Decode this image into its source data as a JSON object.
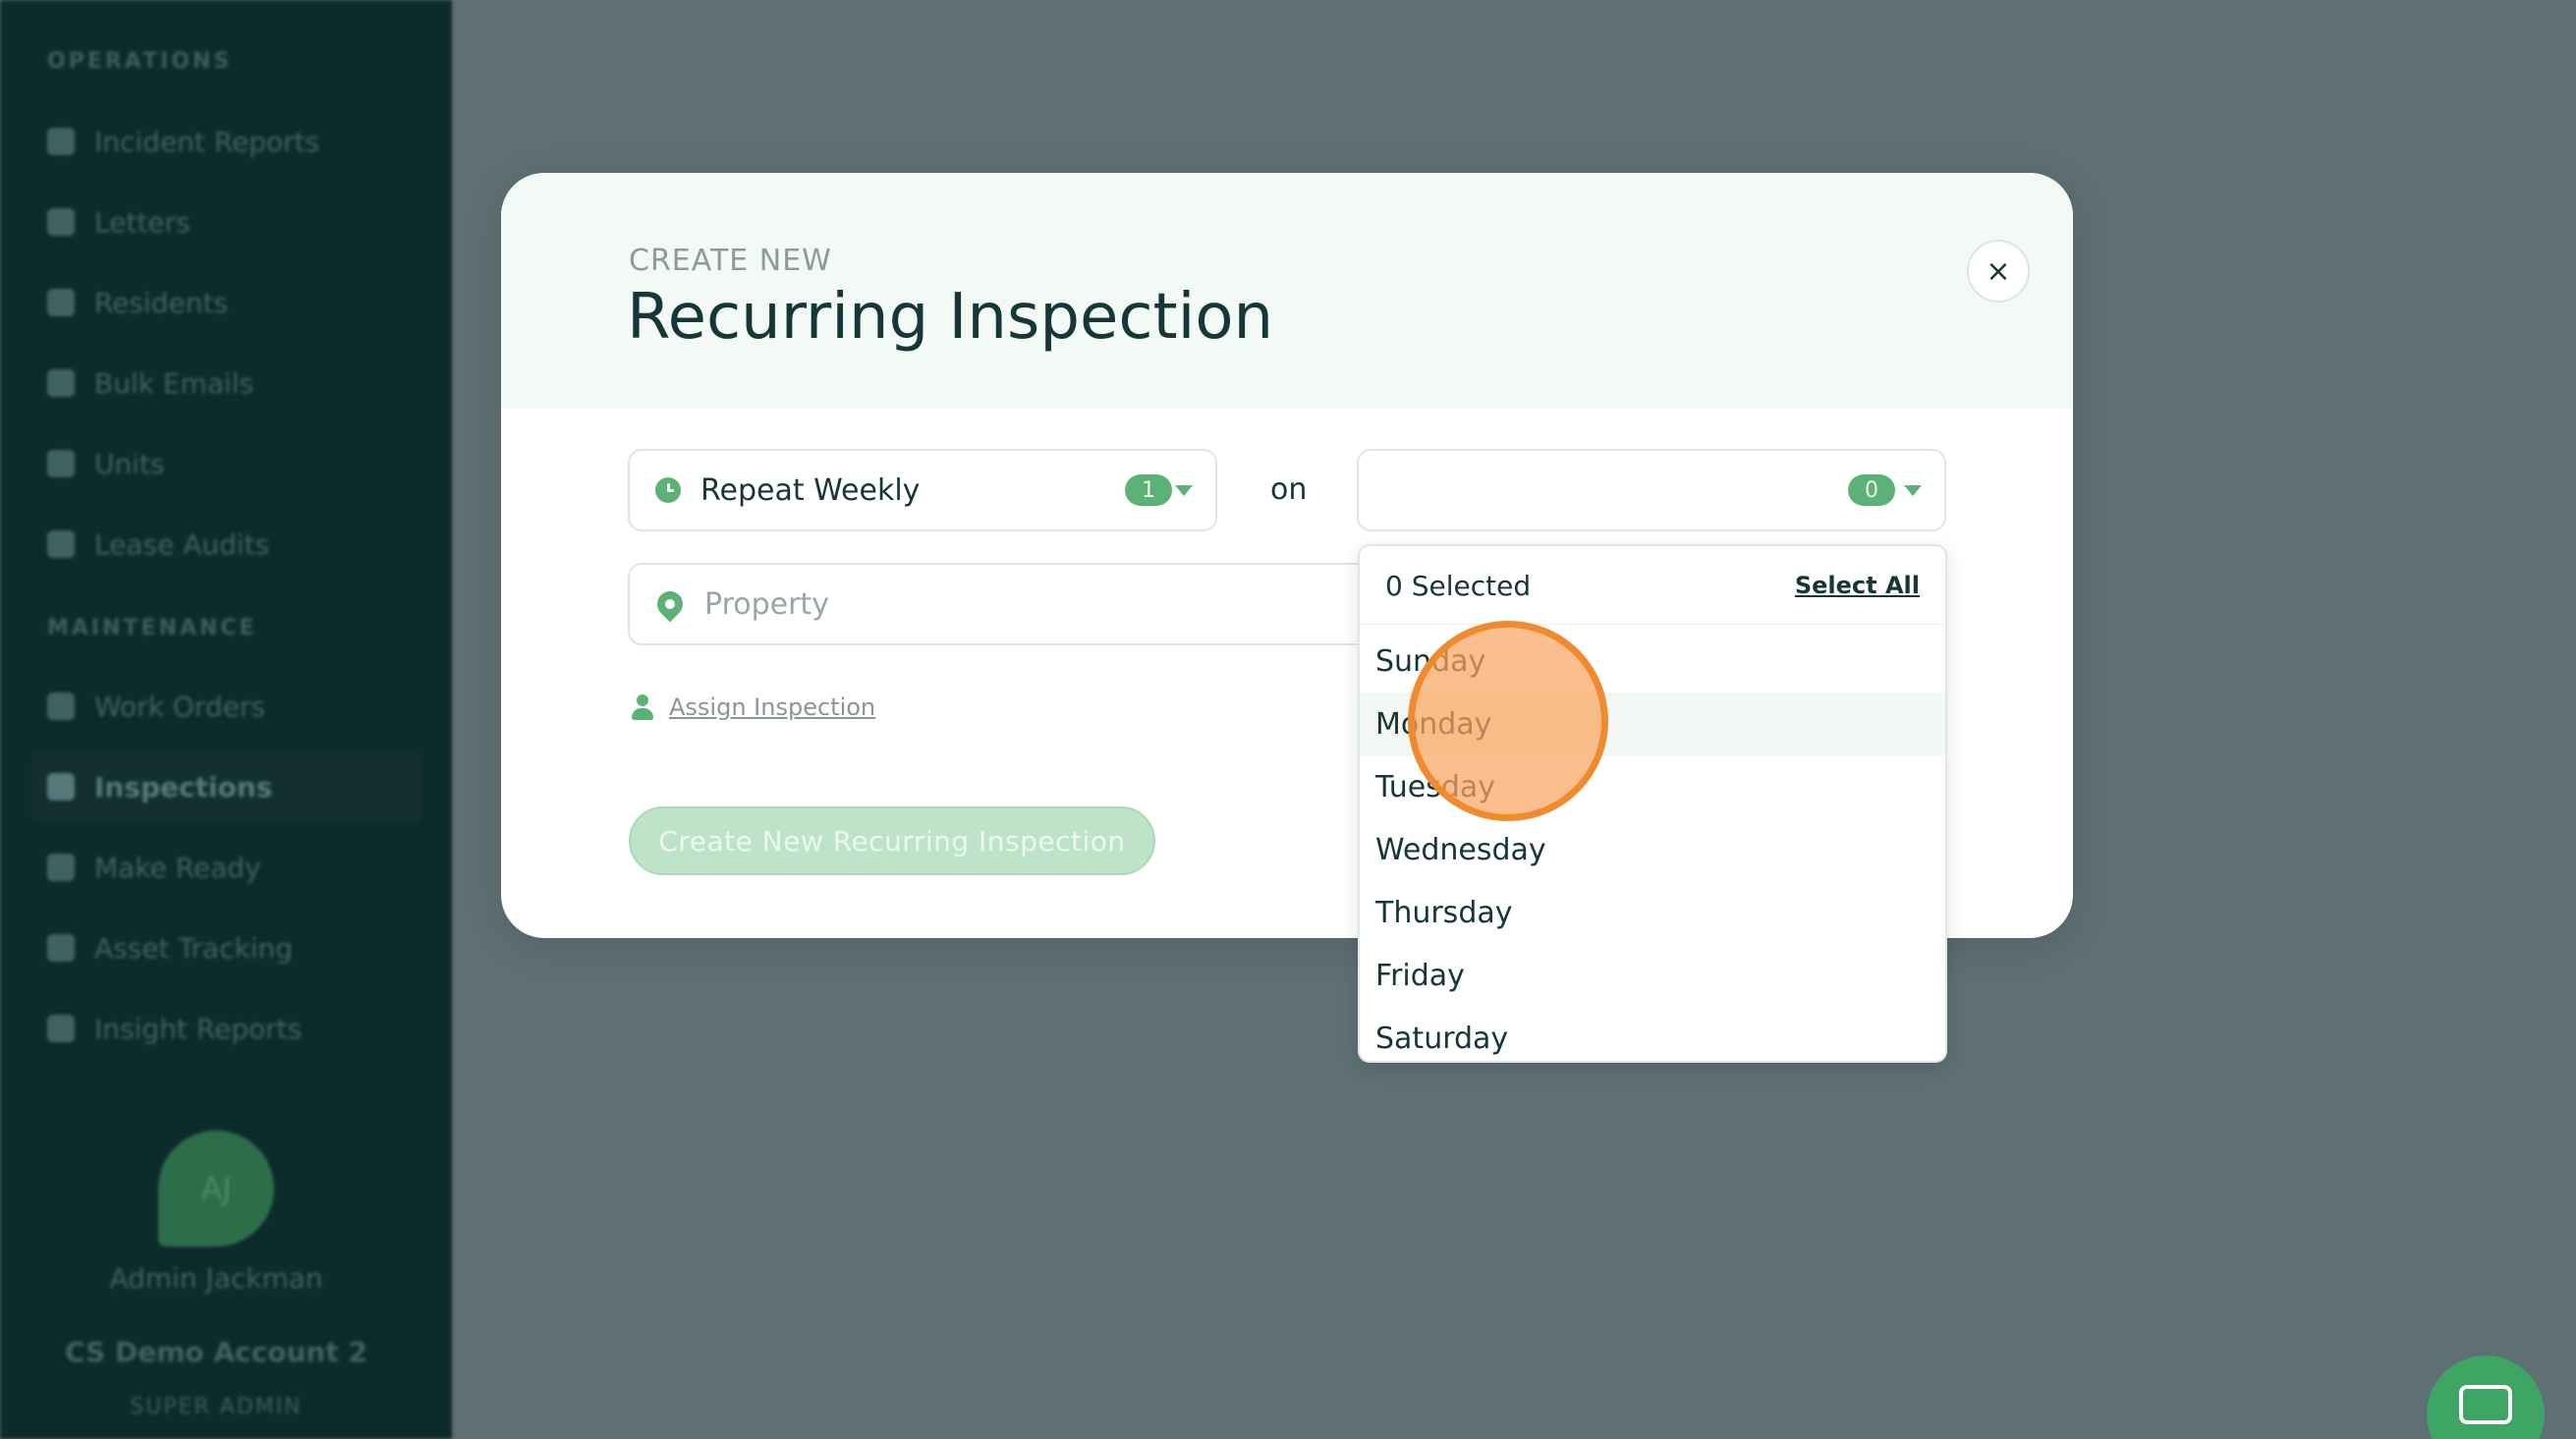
{
  "sidebar": {
    "sections": [
      {
        "title": "OPERATIONS",
        "items": [
          "Incident Reports",
          "Letters",
          "Residents",
          "Bulk Emails",
          "Units",
          "Lease Audits"
        ]
      },
      {
        "title": "MAINTENANCE",
        "items": [
          "Work Orders",
          "Inspections",
          "Make Ready",
          "Asset Tracking",
          "Insight Reports"
        ]
      }
    ],
    "active_item": "Inspections",
    "user": {
      "initials": "AJ",
      "name": "Admin Jackman",
      "account": "CS Demo Account 2",
      "role": "SUPER ADMIN"
    }
  },
  "modal": {
    "kicker": "CREATE NEW",
    "title": "Recurring Inspection",
    "close_label": "×",
    "repeat": {
      "label": "Repeat Weekly",
      "count": "1"
    },
    "on_label": "on",
    "days": {
      "count": "0"
    },
    "property": {
      "placeholder": "Property"
    },
    "assign_label": "Assign Inspection",
    "submit_label": "Create New Recurring Inspection"
  },
  "dropdown": {
    "selected_text": "0 Selected",
    "select_all_label": "Select All",
    "options": [
      "Sunday",
      "Monday",
      "Tuesday",
      "Wednesday",
      "Thursday",
      "Friday",
      "Saturday"
    ],
    "hovered": "Monday"
  },
  "colors": {
    "sidebar_bg": "#0e2b2c",
    "overlay_bg": "#5e7073",
    "accent_green": "#5cb276",
    "text_dark": "#173637",
    "click_indicator": "#f08a2c"
  }
}
